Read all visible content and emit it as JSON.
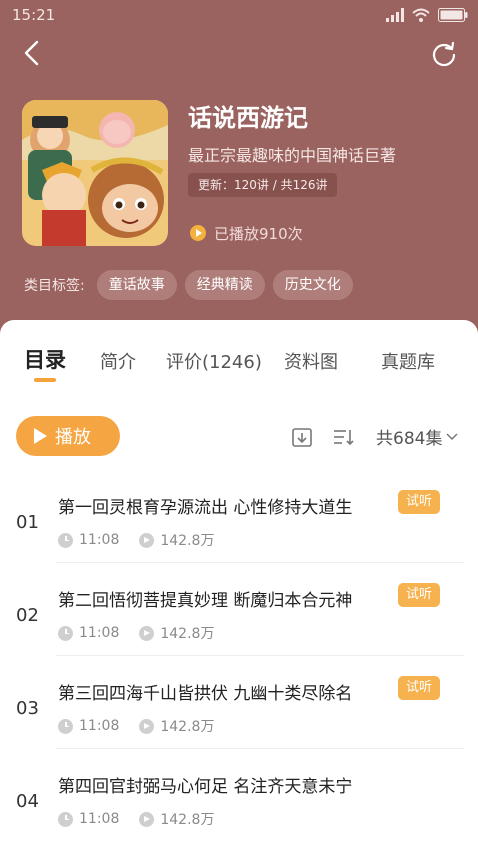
{
  "status_bar": {
    "time": "15:21"
  },
  "album": {
    "title": "话说西游记",
    "subtitle": "最正宗最趣味的中国神话巨著",
    "update_info": "更新：120讲 / 共126讲",
    "played": "已播放910次",
    "tags_label": "类目标签:",
    "tags": [
      "童话故事",
      "经典精读",
      "历史文化"
    ]
  },
  "tabs": [
    {
      "label": "目录"
    },
    {
      "label": "简介"
    },
    {
      "label": "评价(1246)"
    },
    {
      "label": "资料图"
    },
    {
      "label": "真题库"
    }
  ],
  "toolbar": {
    "play_label": "播放",
    "episode_count": "共684集",
    "download_icon": "download-icon",
    "sort_icon": "sort-icon"
  },
  "episodes": [
    {
      "number": "01",
      "title": "第一回灵根育孕源流出 心性修持大道生",
      "badge": "试听",
      "duration": "11:08",
      "plays": "142.8万"
    },
    {
      "number": "02",
      "title": "第二回悟彻菩提真妙理 断魔归本合元神",
      "badge": "试听",
      "duration": "11:08",
      "plays": "142.8万"
    },
    {
      "number": "03",
      "title": "第三回四海千山皆拱伏 九幽十类尽除名",
      "badge": "试听",
      "duration": "11:08",
      "plays": "142.8万"
    },
    {
      "number": "04",
      "title": "第四回官封弼马心何足 名注齐天意未宁",
      "badge": "",
      "duration": "11:08",
      "plays": "142.8万"
    }
  ],
  "colors": {
    "header_bg": "#9a635f",
    "accent": "#f5a541",
    "badge": "#f6b24e"
  }
}
